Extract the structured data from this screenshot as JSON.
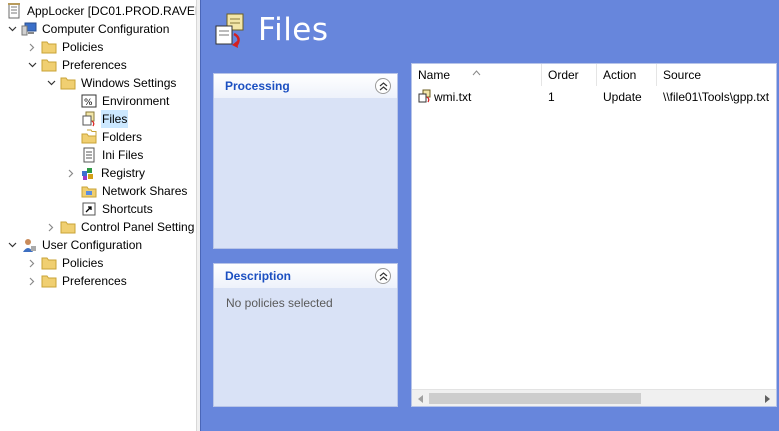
{
  "tree": {
    "items": [
      {
        "label": "AppLocker [DC01.PROD.RAVEN",
        "icon": "policy-document-icon"
      },
      {
        "label": "Computer Configuration",
        "icon": "computer-icon"
      },
      {
        "label": "Policies",
        "icon": "folder-icon"
      },
      {
        "label": "Preferences",
        "icon": "folder-icon"
      },
      {
        "label": "Windows Settings",
        "icon": "folder-icon"
      },
      {
        "label": "Environment",
        "icon": "environment-icon"
      },
      {
        "label": "Files",
        "icon": "files-icon"
      },
      {
        "label": "Folders",
        "icon": "folders-icon"
      },
      {
        "label": "Ini Files",
        "icon": "ini-files-icon"
      },
      {
        "label": "Registry",
        "icon": "registry-icon"
      },
      {
        "label": "Network Shares",
        "icon": "network-shares-icon"
      },
      {
        "label": "Shortcuts",
        "icon": "shortcuts-icon"
      },
      {
        "label": "Control Panel Setting",
        "icon": "folder-icon"
      },
      {
        "label": "User Configuration",
        "icon": "user-icon"
      },
      {
        "label": "Policies",
        "icon": "folder-icon"
      },
      {
        "label": "Preferences",
        "icon": "folder-icon"
      }
    ]
  },
  "header": {
    "title": "Files",
    "icon": "files-icon"
  },
  "processing": {
    "title": "Processing",
    "body": ""
  },
  "description": {
    "title": "Description",
    "body": "No policies selected"
  },
  "list": {
    "columns": [
      "Name",
      "Order",
      "Action",
      "Source"
    ],
    "rows": [
      {
        "name": "wmi.txt",
        "order": "1",
        "action": "Update",
        "source": "\\\\file01\\Tools\\gpp.txt"
      }
    ]
  },
  "colors": {
    "accent": "#6786dc",
    "panel": "#d9e2f6",
    "panel_title": "#1b4fc1",
    "selection": "#cce8ff"
  }
}
